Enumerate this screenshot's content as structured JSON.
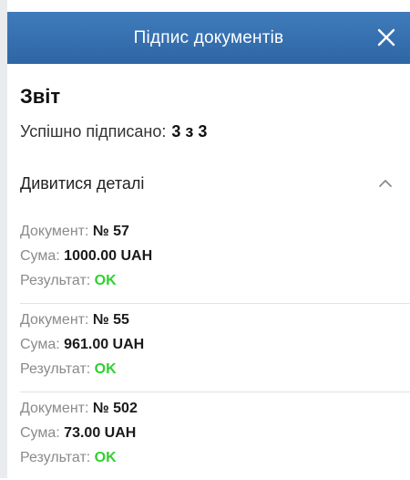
{
  "header": {
    "title": "Підпис документів"
  },
  "icons": {
    "close": "close-icon",
    "chevron": "chevron-up-icon"
  },
  "report": {
    "title": "Звіт",
    "signed_label": "Успішно підписано:",
    "signed_value": "3 з 3",
    "details_label": "Дивитися деталі"
  },
  "documents": [
    {
      "doc_label": "Документ:",
      "doc_value": "№ 57",
      "sum_label": "Сума:",
      "sum_value": "1000.00 UAH",
      "result_label": "Результат:",
      "result_value": "OK"
    },
    {
      "doc_label": "Документ:",
      "doc_value": "№ 55",
      "sum_label": "Сума:",
      "sum_value": "961.00 UAH",
      "result_label": "Результат:",
      "result_value": "OK"
    },
    {
      "doc_label": "Документ:",
      "doc_value": "№ 502",
      "sum_label": "Сума:",
      "sum_value": "73.00 UAH",
      "result_label": "Результат:",
      "result_value": "OK"
    }
  ],
  "colors": {
    "header_top": "#3f7bbb",
    "header_bottom": "#2e66a5",
    "ok": "#2fd12f",
    "label": "#8a8a8a"
  }
}
